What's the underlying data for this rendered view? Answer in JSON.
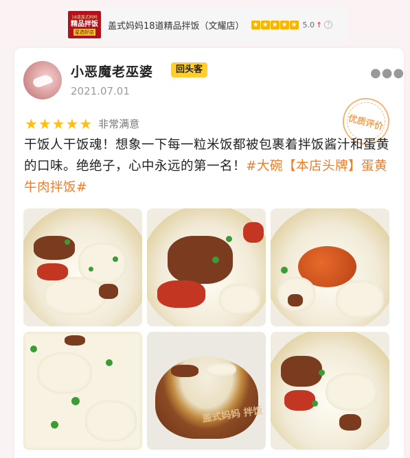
{
  "store": {
    "logo": {
      "line1": "18道盖式妈妈",
      "line2": "精品拌饭",
      "line3": "星选好店"
    },
    "name": "盖式妈妈18道精品拌饭（文耀店）",
    "score": "5.0",
    "star_count": 5,
    "colors": {
      "logo_bg": "#b3121b",
      "star": "#f7b500"
    }
  },
  "review": {
    "user_name": "小恶魔老巫婆",
    "badge": "回头客",
    "date": "2021.07.01",
    "rating_label": "非常满意",
    "stars": 5,
    "stamp": "优质评价",
    "text_main": "干饭人干饭魂！想象一下每一粒米饭都被包裹着拌饭酱汁和蛋黄的口味。绝绝子，心中永远的第一名！",
    "tag": "#大碗【本店头牌】蛋黄牛肉拌饭#",
    "colors": {
      "tag": "#f07c26",
      "badge_bg": "#ffcf2e",
      "star": "#ffbf12"
    }
  },
  "photos": [
    {
      "subject": "beef-cabbage-rice-bowl"
    },
    {
      "subject": "beef-pepper-closeup"
    },
    {
      "subject": "egg-yolk-sauce-bowl"
    },
    {
      "subject": "cabbage-scallion-closeup"
    },
    {
      "subject": "rice-bowl-with-logo",
      "bowl_print": "盖式妈妈 拌饭"
    },
    {
      "subject": "beef-rice-bowl"
    }
  ],
  "icons": [
    "more-icon",
    "trend-up-icon",
    "help-icon",
    "star-icon"
  ]
}
